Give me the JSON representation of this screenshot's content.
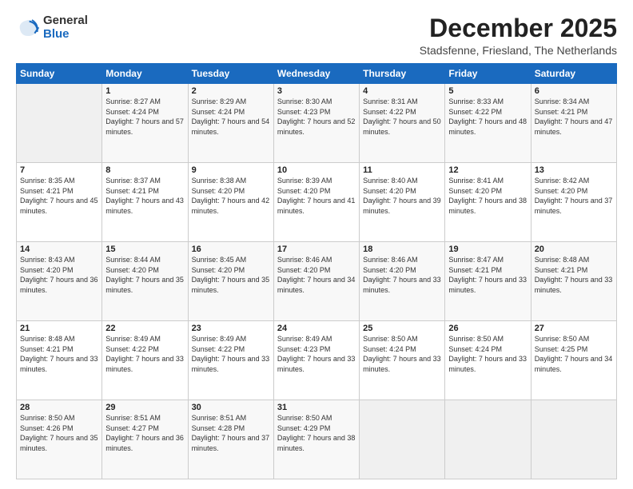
{
  "logo": {
    "general": "General",
    "blue": "Blue"
  },
  "header": {
    "month": "December 2025",
    "location": "Stadsfenne, Friesland, The Netherlands"
  },
  "days_header": [
    "Sunday",
    "Monday",
    "Tuesday",
    "Wednesday",
    "Thursday",
    "Friday",
    "Saturday"
  ],
  "weeks": [
    [
      {
        "day": "",
        "sunrise": "",
        "sunset": "",
        "daylight": ""
      },
      {
        "day": "1",
        "sunrise": "Sunrise: 8:27 AM",
        "sunset": "Sunset: 4:24 PM",
        "daylight": "Daylight: 7 hours and 57 minutes."
      },
      {
        "day": "2",
        "sunrise": "Sunrise: 8:29 AM",
        "sunset": "Sunset: 4:24 PM",
        "daylight": "Daylight: 7 hours and 54 minutes."
      },
      {
        "day": "3",
        "sunrise": "Sunrise: 8:30 AM",
        "sunset": "Sunset: 4:23 PM",
        "daylight": "Daylight: 7 hours and 52 minutes."
      },
      {
        "day": "4",
        "sunrise": "Sunrise: 8:31 AM",
        "sunset": "Sunset: 4:22 PM",
        "daylight": "Daylight: 7 hours and 50 minutes."
      },
      {
        "day": "5",
        "sunrise": "Sunrise: 8:33 AM",
        "sunset": "Sunset: 4:22 PM",
        "daylight": "Daylight: 7 hours and 48 minutes."
      },
      {
        "day": "6",
        "sunrise": "Sunrise: 8:34 AM",
        "sunset": "Sunset: 4:21 PM",
        "daylight": "Daylight: 7 hours and 47 minutes."
      }
    ],
    [
      {
        "day": "7",
        "sunrise": "Sunrise: 8:35 AM",
        "sunset": "Sunset: 4:21 PM",
        "daylight": "Daylight: 7 hours and 45 minutes."
      },
      {
        "day": "8",
        "sunrise": "Sunrise: 8:37 AM",
        "sunset": "Sunset: 4:21 PM",
        "daylight": "Daylight: 7 hours and 43 minutes."
      },
      {
        "day": "9",
        "sunrise": "Sunrise: 8:38 AM",
        "sunset": "Sunset: 4:20 PM",
        "daylight": "Daylight: 7 hours and 42 minutes."
      },
      {
        "day": "10",
        "sunrise": "Sunrise: 8:39 AM",
        "sunset": "Sunset: 4:20 PM",
        "daylight": "Daylight: 7 hours and 41 minutes."
      },
      {
        "day": "11",
        "sunrise": "Sunrise: 8:40 AM",
        "sunset": "Sunset: 4:20 PM",
        "daylight": "Daylight: 7 hours and 39 minutes."
      },
      {
        "day": "12",
        "sunrise": "Sunrise: 8:41 AM",
        "sunset": "Sunset: 4:20 PM",
        "daylight": "Daylight: 7 hours and 38 minutes."
      },
      {
        "day": "13",
        "sunrise": "Sunrise: 8:42 AM",
        "sunset": "Sunset: 4:20 PM",
        "daylight": "Daylight: 7 hours and 37 minutes."
      }
    ],
    [
      {
        "day": "14",
        "sunrise": "Sunrise: 8:43 AM",
        "sunset": "Sunset: 4:20 PM",
        "daylight": "Daylight: 7 hours and 36 minutes."
      },
      {
        "day": "15",
        "sunrise": "Sunrise: 8:44 AM",
        "sunset": "Sunset: 4:20 PM",
        "daylight": "Daylight: 7 hours and 35 minutes."
      },
      {
        "day": "16",
        "sunrise": "Sunrise: 8:45 AM",
        "sunset": "Sunset: 4:20 PM",
        "daylight": "Daylight: 7 hours and 35 minutes."
      },
      {
        "day": "17",
        "sunrise": "Sunrise: 8:46 AM",
        "sunset": "Sunset: 4:20 PM",
        "daylight": "Daylight: 7 hours and 34 minutes."
      },
      {
        "day": "18",
        "sunrise": "Sunrise: 8:46 AM",
        "sunset": "Sunset: 4:20 PM",
        "daylight": "Daylight: 7 hours and 33 minutes."
      },
      {
        "day": "19",
        "sunrise": "Sunrise: 8:47 AM",
        "sunset": "Sunset: 4:21 PM",
        "daylight": "Daylight: 7 hours and 33 minutes."
      },
      {
        "day": "20",
        "sunrise": "Sunrise: 8:48 AM",
        "sunset": "Sunset: 4:21 PM",
        "daylight": "Daylight: 7 hours and 33 minutes."
      }
    ],
    [
      {
        "day": "21",
        "sunrise": "Sunrise: 8:48 AM",
        "sunset": "Sunset: 4:21 PM",
        "daylight": "Daylight: 7 hours and 33 minutes."
      },
      {
        "day": "22",
        "sunrise": "Sunrise: 8:49 AM",
        "sunset": "Sunset: 4:22 PM",
        "daylight": "Daylight: 7 hours and 33 minutes."
      },
      {
        "day": "23",
        "sunrise": "Sunrise: 8:49 AM",
        "sunset": "Sunset: 4:22 PM",
        "daylight": "Daylight: 7 hours and 33 minutes."
      },
      {
        "day": "24",
        "sunrise": "Sunrise: 8:49 AM",
        "sunset": "Sunset: 4:23 PM",
        "daylight": "Daylight: 7 hours and 33 minutes."
      },
      {
        "day": "25",
        "sunrise": "Sunrise: 8:50 AM",
        "sunset": "Sunset: 4:24 PM",
        "daylight": "Daylight: 7 hours and 33 minutes."
      },
      {
        "day": "26",
        "sunrise": "Sunrise: 8:50 AM",
        "sunset": "Sunset: 4:24 PM",
        "daylight": "Daylight: 7 hours and 33 minutes."
      },
      {
        "day": "27",
        "sunrise": "Sunrise: 8:50 AM",
        "sunset": "Sunset: 4:25 PM",
        "daylight": "Daylight: 7 hours and 34 minutes."
      }
    ],
    [
      {
        "day": "28",
        "sunrise": "Sunrise: 8:50 AM",
        "sunset": "Sunset: 4:26 PM",
        "daylight": "Daylight: 7 hours and 35 minutes."
      },
      {
        "day": "29",
        "sunrise": "Sunrise: 8:51 AM",
        "sunset": "Sunset: 4:27 PM",
        "daylight": "Daylight: 7 hours and 36 minutes."
      },
      {
        "day": "30",
        "sunrise": "Sunrise: 8:51 AM",
        "sunset": "Sunset: 4:28 PM",
        "daylight": "Daylight: 7 hours and 37 minutes."
      },
      {
        "day": "31",
        "sunrise": "Sunrise: 8:50 AM",
        "sunset": "Sunset: 4:29 PM",
        "daylight": "Daylight: 7 hours and 38 minutes."
      },
      {
        "day": "",
        "sunrise": "",
        "sunset": "",
        "daylight": ""
      },
      {
        "day": "",
        "sunrise": "",
        "sunset": "",
        "daylight": ""
      },
      {
        "day": "",
        "sunrise": "",
        "sunset": "",
        "daylight": ""
      }
    ]
  ]
}
